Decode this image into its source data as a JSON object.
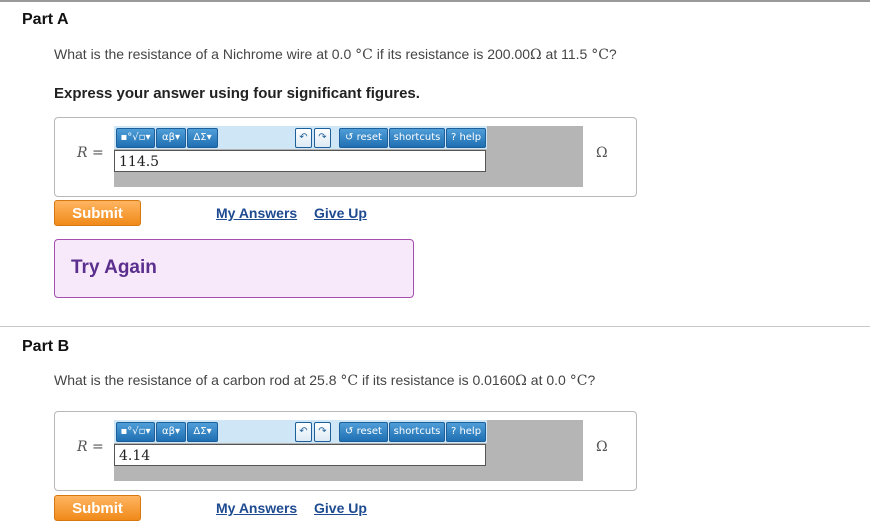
{
  "part_a": {
    "title": "Part A",
    "question": {
      "pre": "What is the resistance of a Nichrome wire at 0.0 ",
      "deg_c_1": "°C",
      "mid": " if its resistance is 200.00",
      "ohm": "Ω",
      "mid2": " at 11.5 ",
      "deg_c_2": "°C",
      "post": "?"
    },
    "instruction": "Express your answer using four significant figures.",
    "answer": {
      "variable": "R",
      "equals": " =",
      "value": "114.5",
      "unit": "Ω"
    },
    "submit_label": "Submit",
    "my_answers_label": "My Answers",
    "give_up_label": "Give Up",
    "feedback": "Try Again"
  },
  "part_b": {
    "title": "Part B",
    "question": {
      "pre": "What is the resistance of a carbon rod at 25.8 ",
      "deg_c_1": "°C",
      "mid": " if its resistance is 0.0160",
      "ohm": "Ω",
      "mid2": " at 0.0 ",
      "deg_c_2": "°C",
      "post": "?"
    },
    "answer": {
      "variable": "R",
      "equals": " =",
      "value": "4.14",
      "unit": "Ω"
    },
    "submit_label": "Submit",
    "my_answers_label": "My Answers",
    "give_up_label": "Give Up"
  },
  "toolbar": {
    "templates_label": "▪°√▫",
    "greek_label": "αβ",
    "symbols_label": "ΔΣ",
    "dropdown_marker": "▾",
    "undo_glyph": "↶",
    "redo_glyph": "↷",
    "reset_label": "reset",
    "reset_glyph": "↺",
    "shortcuts_label": "shortcuts",
    "help_label": "help",
    "help_glyph": "?"
  }
}
